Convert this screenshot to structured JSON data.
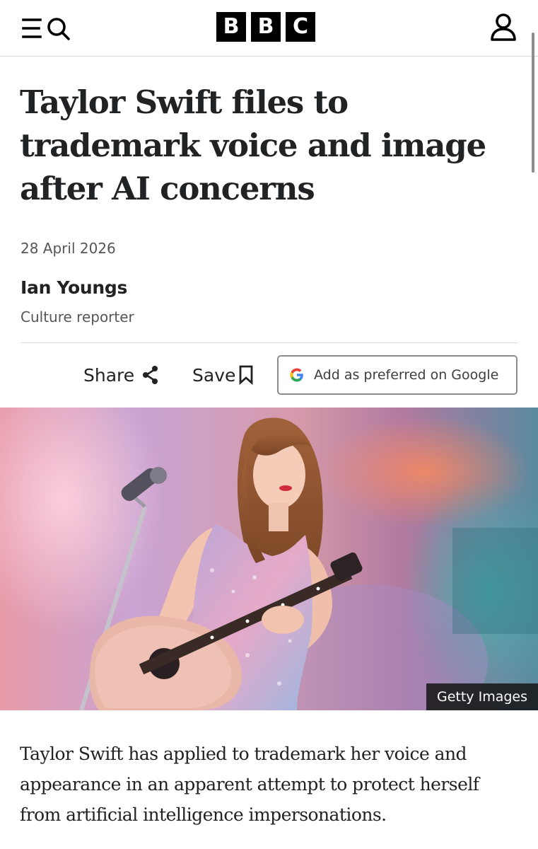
{
  "header": {
    "menu_icon": "hamburger-menu-icon",
    "search_icon": "search-icon",
    "logo_letters": [
      "B",
      "B",
      "C"
    ],
    "account_icon": "user-account-icon"
  },
  "article": {
    "headline": "Taylor Swift files to trademark voice and image after AI concerns",
    "date": "28 April 2026",
    "author": {
      "name": "Ian Youngs",
      "role": "Culture reporter"
    },
    "actions": {
      "share_label": "Share",
      "share_icon": "share-icon",
      "save_label": "Save",
      "save_icon": "bookmark-icon",
      "google_label": "Add as preferred on Google",
      "google_icon": "google-logo-icon"
    },
    "image": {
      "credit": "Getty Images"
    },
    "lead": "Taylor Swift has applied to trademark her voice and appearance in an apparent attempt to protect herself from artificial intelligence impersonations."
  },
  "colors": {
    "text": "#202224",
    "muted_text": "#545658",
    "logo_background": "#000000",
    "google_blue": "#4285F4",
    "google_red": "#EA4335",
    "google_yellow": "#FBBC05",
    "google_green": "#34A853"
  }
}
